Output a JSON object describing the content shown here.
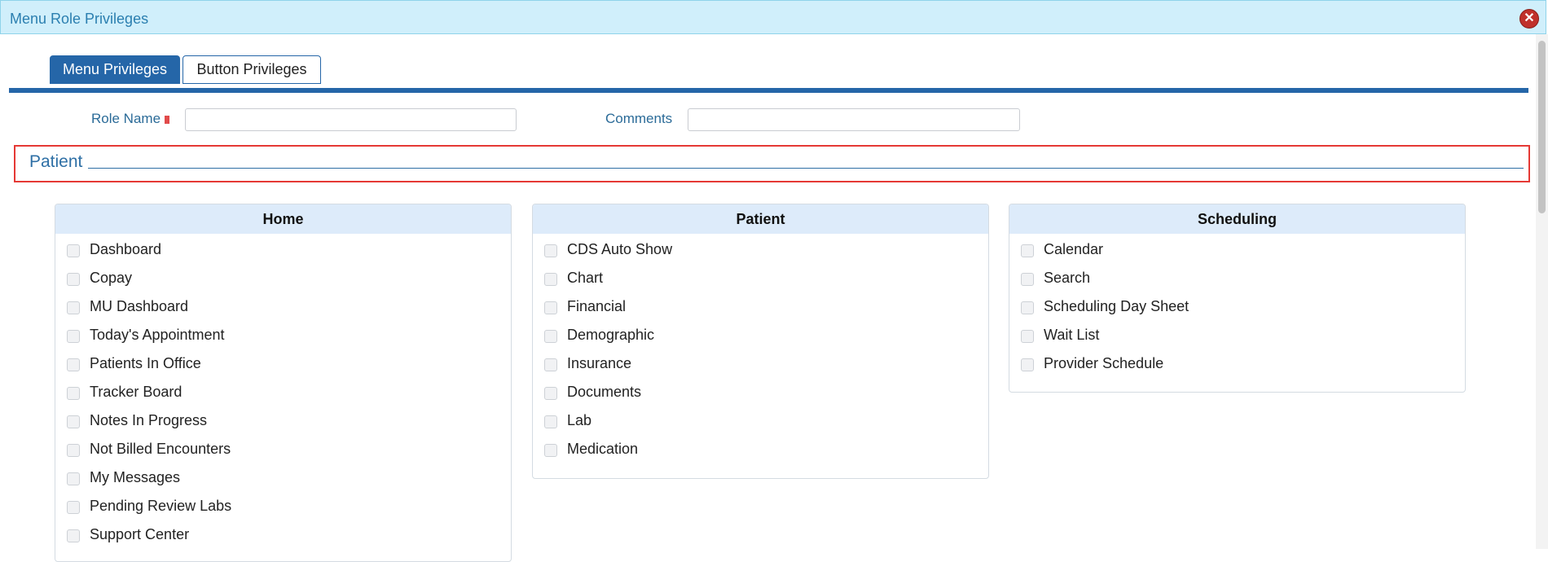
{
  "window": {
    "title": "Menu Role Privileges",
    "close_icon": "close-icon"
  },
  "tabs": [
    {
      "label": "Menu Privileges",
      "active": true
    },
    {
      "label": "Button Privileges",
      "active": false
    }
  ],
  "form": {
    "role_name_label": "Role Name",
    "role_name_value": "",
    "comments_label": "Comments",
    "comments_value": ""
  },
  "section": {
    "title": "Patient"
  },
  "panels": [
    {
      "header": "Home",
      "items": [
        "Dashboard",
        "Copay",
        "MU Dashboard",
        "Today's Appointment",
        "Patients In Office",
        "Tracker Board",
        "Notes In Progress",
        "Not Billed Encounters",
        "My Messages",
        "Pending Review Labs",
        "Support Center"
      ]
    },
    {
      "header": "Patient",
      "items": [
        "CDS Auto Show",
        "Chart",
        "Financial",
        "Demographic",
        "Insurance",
        "Documents",
        "Lab",
        "Medication"
      ]
    },
    {
      "header": "Scheduling",
      "items": [
        "Calendar",
        "Search",
        "Scheduling Day Sheet",
        "Wait List",
        "Provider Schedule"
      ]
    }
  ],
  "colors": {
    "accent": "#2566a8",
    "titlebar": "#d0effb",
    "section_border": "#e53935",
    "panel_header": "#ddebfa"
  }
}
